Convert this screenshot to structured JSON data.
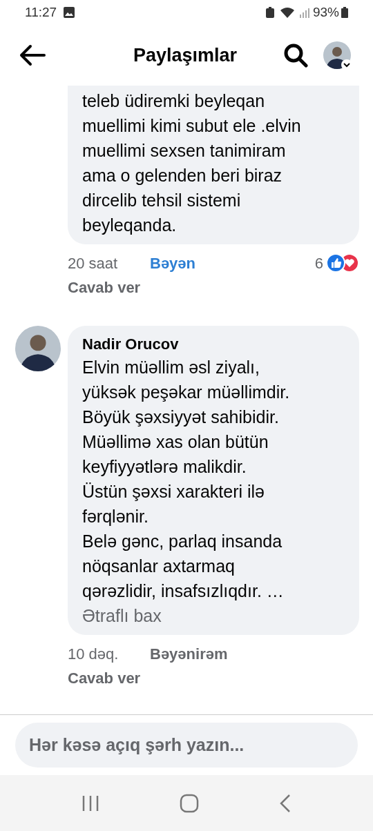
{
  "status_bar": {
    "time": "11:27",
    "battery": "93%"
  },
  "header": {
    "title": "Paylaşımlar"
  },
  "comments": [
    {
      "text": "teleb üdiremki beyleqan\nmuellimi kimi subut ele .elvin\nmuellimi sexsen tanimiram\nama o gelenden beri biraz\ndircelib tehsil sistemi\nbeyleqanda.",
      "time": "20 saat",
      "like_label": "Bəyən",
      "liked": true,
      "reply": "Cavab ver",
      "reaction_count": "6"
    },
    {
      "author": "Nadir Orucov",
      "text": "Elvin müəllim əsl ziyalı,\nyüksək peşəkar müəllimdir.\nBöyük şəxsiyyət sahibidir.\nMüəllimə xas olan bütün\nkeyfiyyətlərə malikdir.\nÜstün şəxsi xarakteri ilə\nfərqlənir.\nBelə gənc, parlaq insanda\nnöqsanlar axtarmaq\nqərəzlidir, insafsızlıqdır. …",
      "more": "Ətraflı bax",
      "time": "10 dəq.",
      "like_label": "Bəyənirəm",
      "liked": false,
      "reply": "Cavab ver"
    }
  ],
  "composer": {
    "placeholder": "Hər kəsə açıq şərh yazın..."
  }
}
